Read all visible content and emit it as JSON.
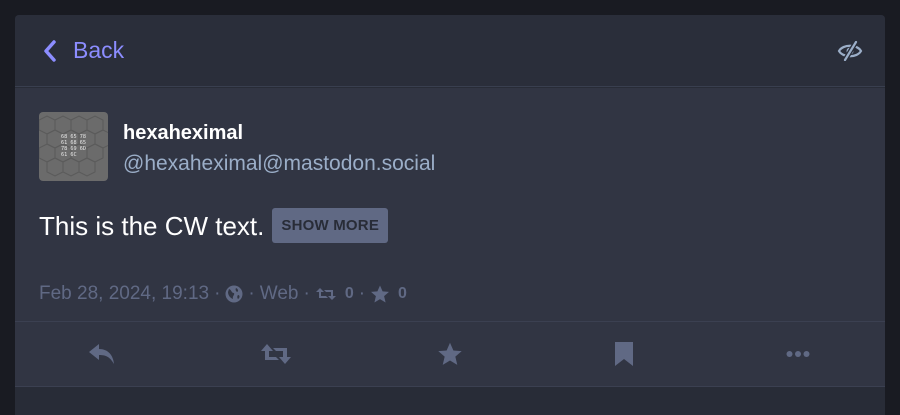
{
  "header": {
    "back_label": "Back"
  },
  "status": {
    "display_name": "hexaheximal",
    "acct": "@hexaheximal@mastodon.social",
    "avatar_text": [
      "68 65 78",
      "61 68 65",
      "78 69 6D",
      "61 6C"
    ],
    "cw_text": "This is the CW text.",
    "show_more_label": "SHOW MORE",
    "timestamp": "Feb 28, 2024, 19:13",
    "visibility_icon": "globe-icon",
    "application": "Web",
    "reblogs_count": "0",
    "favourites_count": "0"
  },
  "actions": [
    "reply-icon",
    "boost-icon",
    "star-icon",
    "bookmark-icon",
    "more-icon"
  ],
  "colors": {
    "background": "#191b22",
    "column": "#282c37",
    "status": "#313543",
    "accent": "#8c8dff",
    "muted": "#606984",
    "secondary": "#9baec8"
  }
}
